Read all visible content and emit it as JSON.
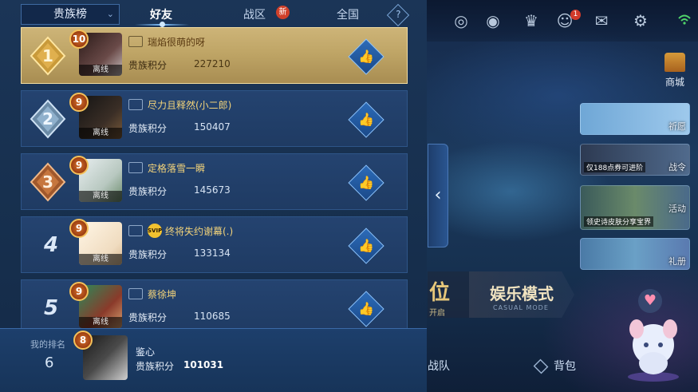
{
  "tabs": {
    "dropdown": "贵族榜",
    "friends": "好友",
    "battle_zone": "战区",
    "battle_zone_badge": "新",
    "national": "全国",
    "help": "?"
  },
  "leaderboard": [
    {
      "rank": "1",
      "level": "10",
      "name": "瑞焰很萌的呀",
      "label": "贵族积分",
      "score": "227210",
      "status": "离线"
    },
    {
      "rank": "2",
      "level": "9",
      "name": "尽力且释然(小二郎)",
      "label": "贵族积分",
      "score": "150407",
      "status": "离线"
    },
    {
      "rank": "3",
      "level": "9",
      "name": "定格落雪一瞬",
      "label": "贵族积分",
      "score": "145673",
      "status": "离线"
    },
    {
      "rank": "4",
      "level": "9",
      "name": "终将失约谢幕(.)",
      "label": "贵族积分",
      "score": "133134",
      "status": "离线",
      "badge": "SVIP"
    },
    {
      "rank": "5",
      "level": "9",
      "name": "蔡徐坤",
      "label": "贵族积分",
      "score": "110685",
      "status": "离线"
    }
  ],
  "my_rank": {
    "label": "我的排名",
    "rank": "6",
    "level": "8",
    "name": "鉴心",
    "score_label": "贵族积分",
    "score": "101031"
  },
  "right_panel": {
    "shop": "商城",
    "cards": [
      {
        "caption": "祈愿",
        "sub": ""
      },
      {
        "caption": "战令",
        "sub": "仅188点券可进阶"
      },
      {
        "caption": "活动",
        "sub": "领史诗皮肤分享宝界"
      },
      {
        "caption": "礼册",
        "sub": ""
      }
    ],
    "mode_ranked": "位",
    "mode_ranked_sub": "开启",
    "mode_fun": "娱乐模式",
    "mode_fun_sub": "CASUAL MODE",
    "team": "战队",
    "bag": "背包",
    "topbar_badge": "1"
  },
  "colors": {
    "gold_row": "#bfa566",
    "row_bg": "#244370",
    "panel_bg": "#1b3557",
    "name_gold": "#f2d37a"
  }
}
